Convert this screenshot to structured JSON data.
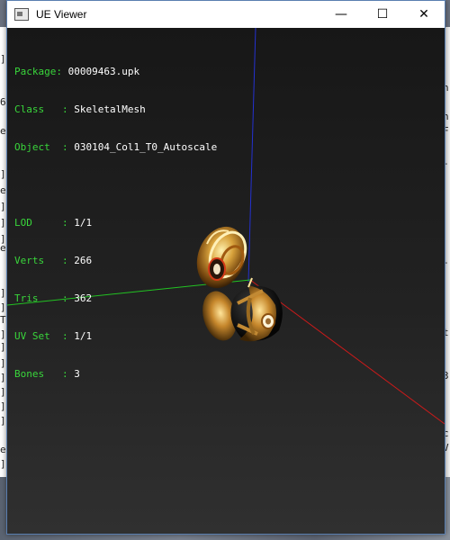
{
  "window": {
    "title": "UE Viewer",
    "minimize": "—",
    "maximize": "☐",
    "close": "✕"
  },
  "info": {
    "package_label": "Package",
    "package": "00009463.upk",
    "class_label": "Class",
    "class": "SkeletalMesh",
    "object_label": "Object",
    "object": "030104_Col1_T0_Autoscale",
    "lod_label": "LOD",
    "lod": "1/1",
    "verts_label": "Verts",
    "verts": "266",
    "tris_label": "Tris",
    "tris": "362",
    "uvset_label": "UV Set",
    "uvset": "1/1",
    "bones_label": "Bones",
    "bones": "3"
  },
  "colors": {
    "label_green": "#39d63b",
    "value_white": "#ffffff",
    "axis_x": "#cc1a1a",
    "axis_y": "#22c322",
    "axis_z": "#2431d0"
  },
  "background": {
    "left_glyphs": [
      "]",
      "6",
      "e",
      "]",
      "e",
      "]",
      "]",
      "]",
      "e",
      "]",
      "]",
      "T",
      "]",
      "]",
      "]",
      "]",
      "]",
      "]",
      "]",
      "e",
      "]"
    ],
    "right_glyphs": [
      "n",
      "n",
      "F",
      "-",
      "-",
      "t",
      "3",
      "c",
      "V"
    ]
  }
}
